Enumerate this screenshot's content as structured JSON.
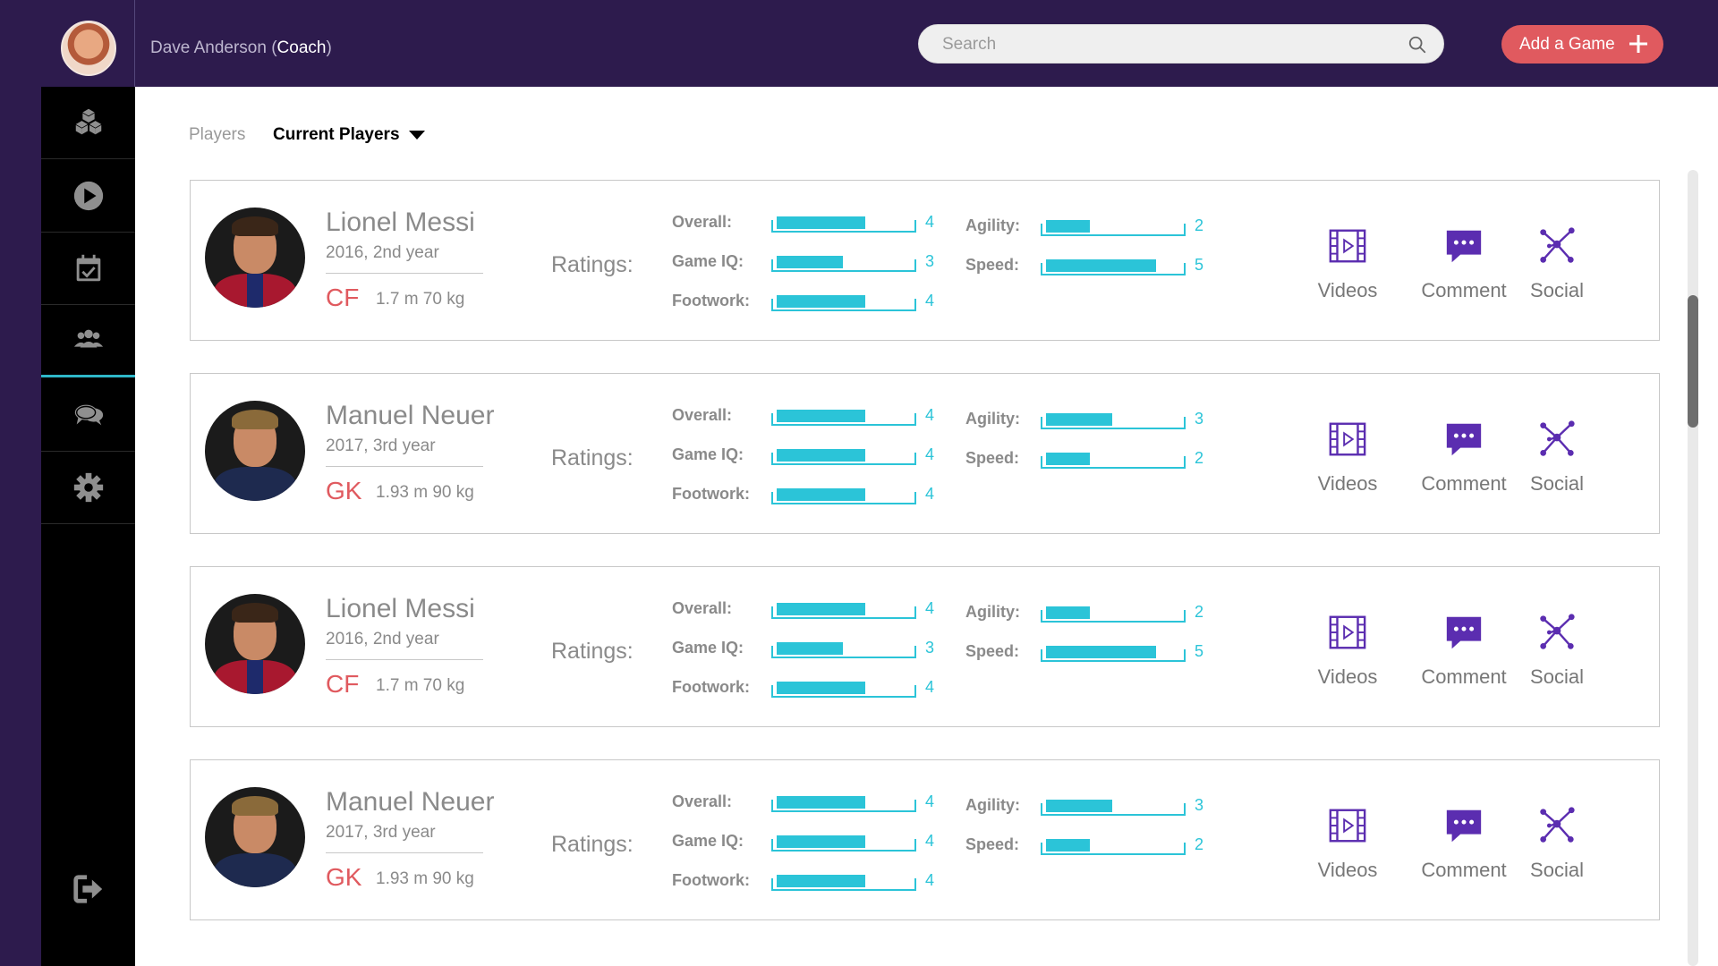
{
  "header": {
    "user_name": "Dave Anderson",
    "user_role": "Coach",
    "search_placeholder": "Search",
    "add_game_label": "Add a Game"
  },
  "sidebar": {
    "items": [
      {
        "icon": "cubes-icon"
      },
      {
        "icon": "play-icon"
      },
      {
        "icon": "calendar-check-icon"
      },
      {
        "icon": "users-icon",
        "active": true
      },
      {
        "icon": "chat-icon"
      },
      {
        "icon": "gear-icon"
      },
      {
        "icon": "logout-icon"
      }
    ]
  },
  "breadcrumb": {
    "root": "Players",
    "current": "Current Players"
  },
  "rating_labels": {
    "overall": "Overall:",
    "game_iq": "Game IQ:",
    "footwork": "Footwork:",
    "agility": "Agility:",
    "speed": "Speed:",
    "ratings": "Ratings:"
  },
  "actions": {
    "videos": "Videos",
    "comment": "Comment",
    "social": "Social"
  },
  "accent_colors": {
    "header_bg": "#2d1b4d",
    "add_button": "#e05a5f",
    "rating_bar": "#2bc4d8",
    "action_icon": "#5b2db0"
  },
  "players": [
    {
      "name": "Lionel Messi",
      "year": "2016, 2nd year",
      "position": "CF",
      "measurements": "1.7 m  70 kg",
      "overall": "4",
      "game_iq": "3",
      "footwork": "4",
      "agility": "2",
      "speed": "5",
      "kit": "red"
    },
    {
      "name": "Manuel Neuer",
      "year": "2017, 3rd year",
      "position": "GK",
      "measurements": "1.93 m 90 kg",
      "overall": "4",
      "game_iq": "4",
      "footwork": "4",
      "agility": "3",
      "speed": "2",
      "kit": "navy"
    },
    {
      "name": "Lionel Messi",
      "year": "2016, 2nd year",
      "position": "CF",
      "measurements": "1.7 m  70 kg",
      "overall": "4",
      "game_iq": "3",
      "footwork": "4",
      "agility": "2",
      "speed": "5",
      "kit": "red"
    },
    {
      "name": "Manuel Neuer",
      "year": "2017, 3rd year",
      "position": "GK",
      "measurements": "1.93 m 90 kg",
      "overall": "4",
      "game_iq": "4",
      "footwork": "4",
      "agility": "3",
      "speed": "2",
      "kit": "navy"
    }
  ]
}
